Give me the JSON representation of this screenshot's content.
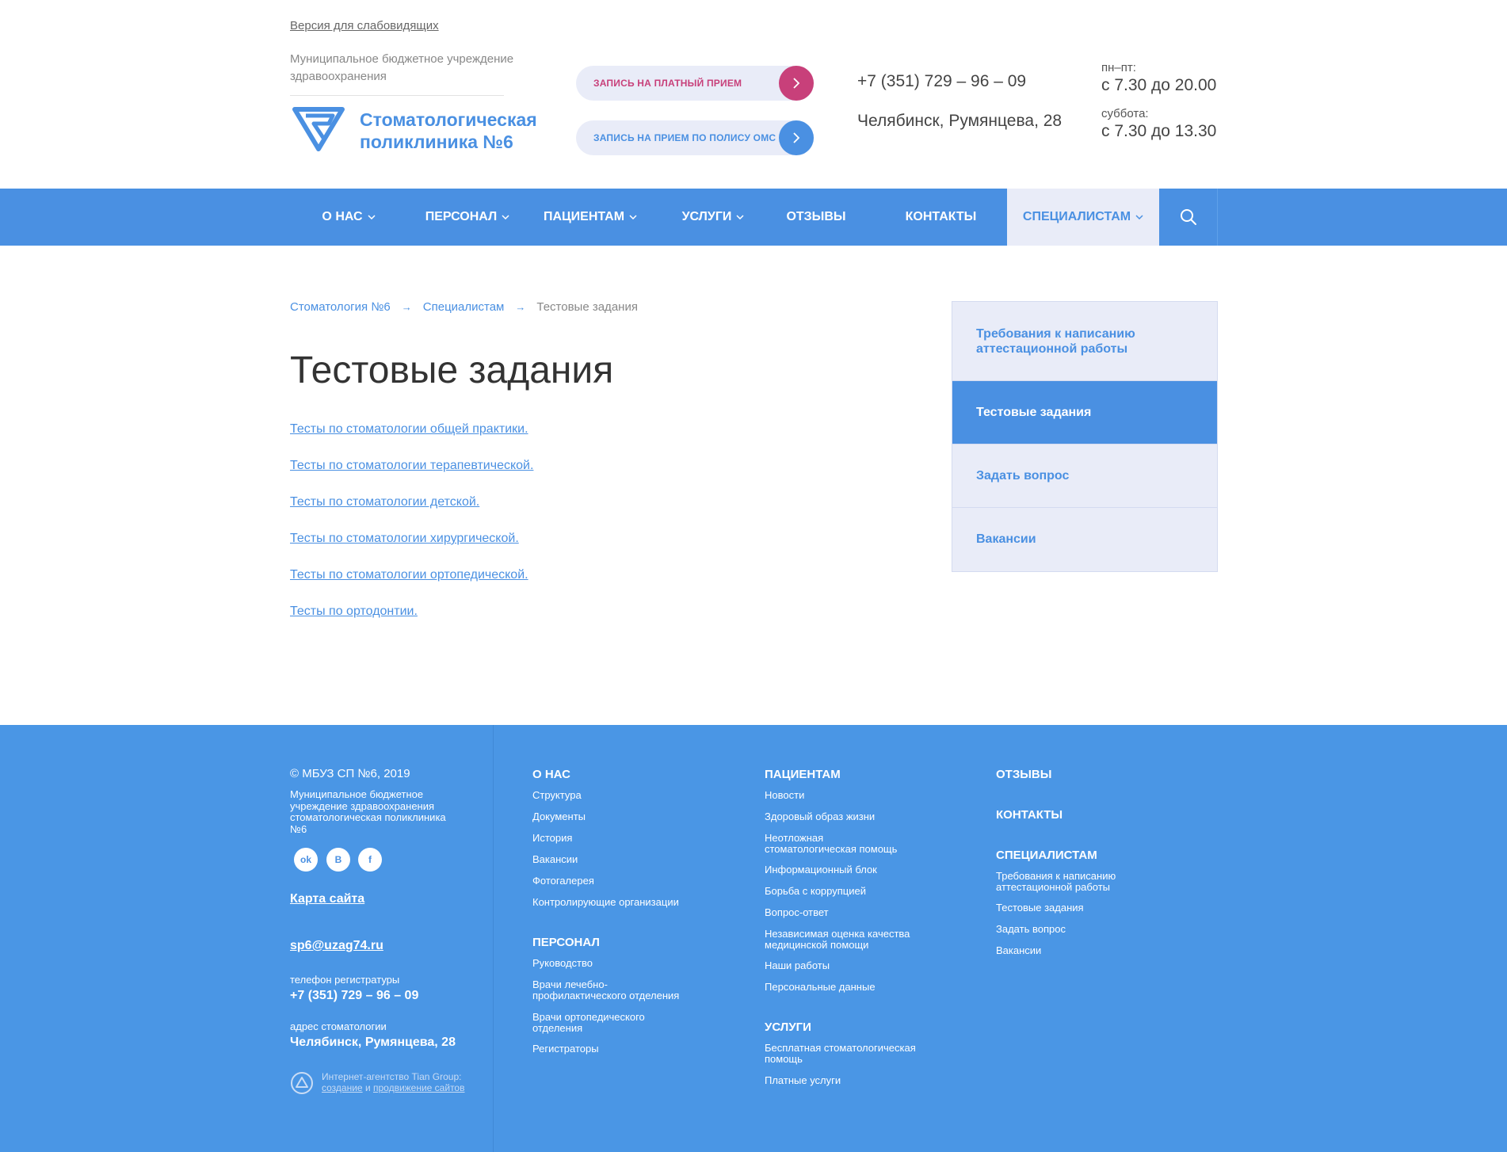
{
  "header": {
    "accessibility_link": "Версия для слабовидящих",
    "org_name": "Муниципальное бюджетное учреждение здравоохранения",
    "logo_text": "Стоматологическая поликлиника №6",
    "btn_paid": "ЗАПИСЬ НА ПЛАТНЫЙ ПРИЕМ",
    "btn_oms": "ЗАПИСЬ НА ПРИЕМ ПО ПОЛИСУ ОМС",
    "phone": "+7 (351) 729 – 96 – 09",
    "address": "Челябинск, Румянцева, 28",
    "weekdays_label": "пн–пт:",
    "weekdays_hours": "с 7.30 до 20.00",
    "saturday_label": "суббота:",
    "saturday_hours": "с 7.30 до 13.30"
  },
  "nav": {
    "items": [
      "О НАС",
      "ПЕРСОНАЛ",
      "ПАЦИЕНТАМ",
      "УСЛУГИ",
      "ОТЗЫВЫ",
      "КОНТАКТЫ",
      "СПЕЦИАЛИСТАМ"
    ],
    "active": "СПЕЦИАЛИСТАМ"
  },
  "breadcrumb": [
    "Стоматология №6",
    "Специалистам",
    "Тестовые задания"
  ],
  "page_title": "Тестовые задания",
  "tests": [
    "Тесты по стоматологии общей практики.",
    "Тесты по стоматологии терапевтической.",
    "Тесты по стоматологии детской.",
    "Тесты по стоматологии хирургической.",
    "Тесты по стоматологии ортопедической.",
    "Тесты по ортодонтии."
  ],
  "sidebar": {
    "items": [
      "Требования к написанию аттестационной работы",
      "Тестовые задания",
      "Задать вопрос",
      "Вакансии"
    ],
    "active_index": 1
  },
  "footer": {
    "copyright": "© МБУЗ СП №6, 2019",
    "org": "Муниципальное бюджетное учреждение здравоохранения стоматологическая поликлиника №6",
    "social": [
      "ok",
      "В",
      "f"
    ],
    "sitemap": "Карта сайта",
    "email": "sp6@uzag74.ru",
    "phone_label": "телефон регистратуры",
    "phone": "+7 (351) 729 – 96 – 09",
    "address_label": "адрес стоматологии",
    "address": "Челябинск, Румянцева, 28",
    "agency_line1": "Интернет-агентство Tian Group:",
    "agency_create": "создание",
    "agency_and": "и",
    "agency_promo": "продвижение сайтов",
    "col_about_title": "О НАС",
    "col_about": [
      "Структура",
      "Документы",
      "История",
      "Вакансии",
      "Фотогалерея",
      "Контролирующие организации"
    ],
    "col_staff_title": "ПЕРСОНАЛ",
    "col_staff": [
      "Руководство",
      "Врачи лечебно-профилактического отделения",
      "Врачи ортопедического отделения",
      "Регистраторы"
    ],
    "col_patients_title": "ПАЦИЕНТАМ",
    "col_patients": [
      "Новости",
      "Здоровый образ жизни",
      "Неотложная стоматологическая помощь",
      "Информационный блок",
      "Борьба с коррупцией",
      "Вопрос-ответ",
      "Независимая оценка качества медицинской помощи",
      "Наши работы",
      "Персональные данные"
    ],
    "col_services_title": "УСЛУГИ",
    "col_services": [
      "Бесплатная стоматологическая помощь",
      "Платные услуги"
    ],
    "col_reviews_title": "ОТЗЫВЫ",
    "col_contacts_title": "КОНТАКТЫ",
    "col_spec_title": "СПЕЦИАЛИСТАМ",
    "col_spec": [
      "Требования к написанию аттестационной работы",
      "Тестовые задания",
      "Задать вопрос",
      "Вакансии"
    ]
  },
  "colors": {
    "brand_blue": "#4a90e2",
    "brand_pink": "#c8407a",
    "light_bg": "#e9ecf8"
  }
}
